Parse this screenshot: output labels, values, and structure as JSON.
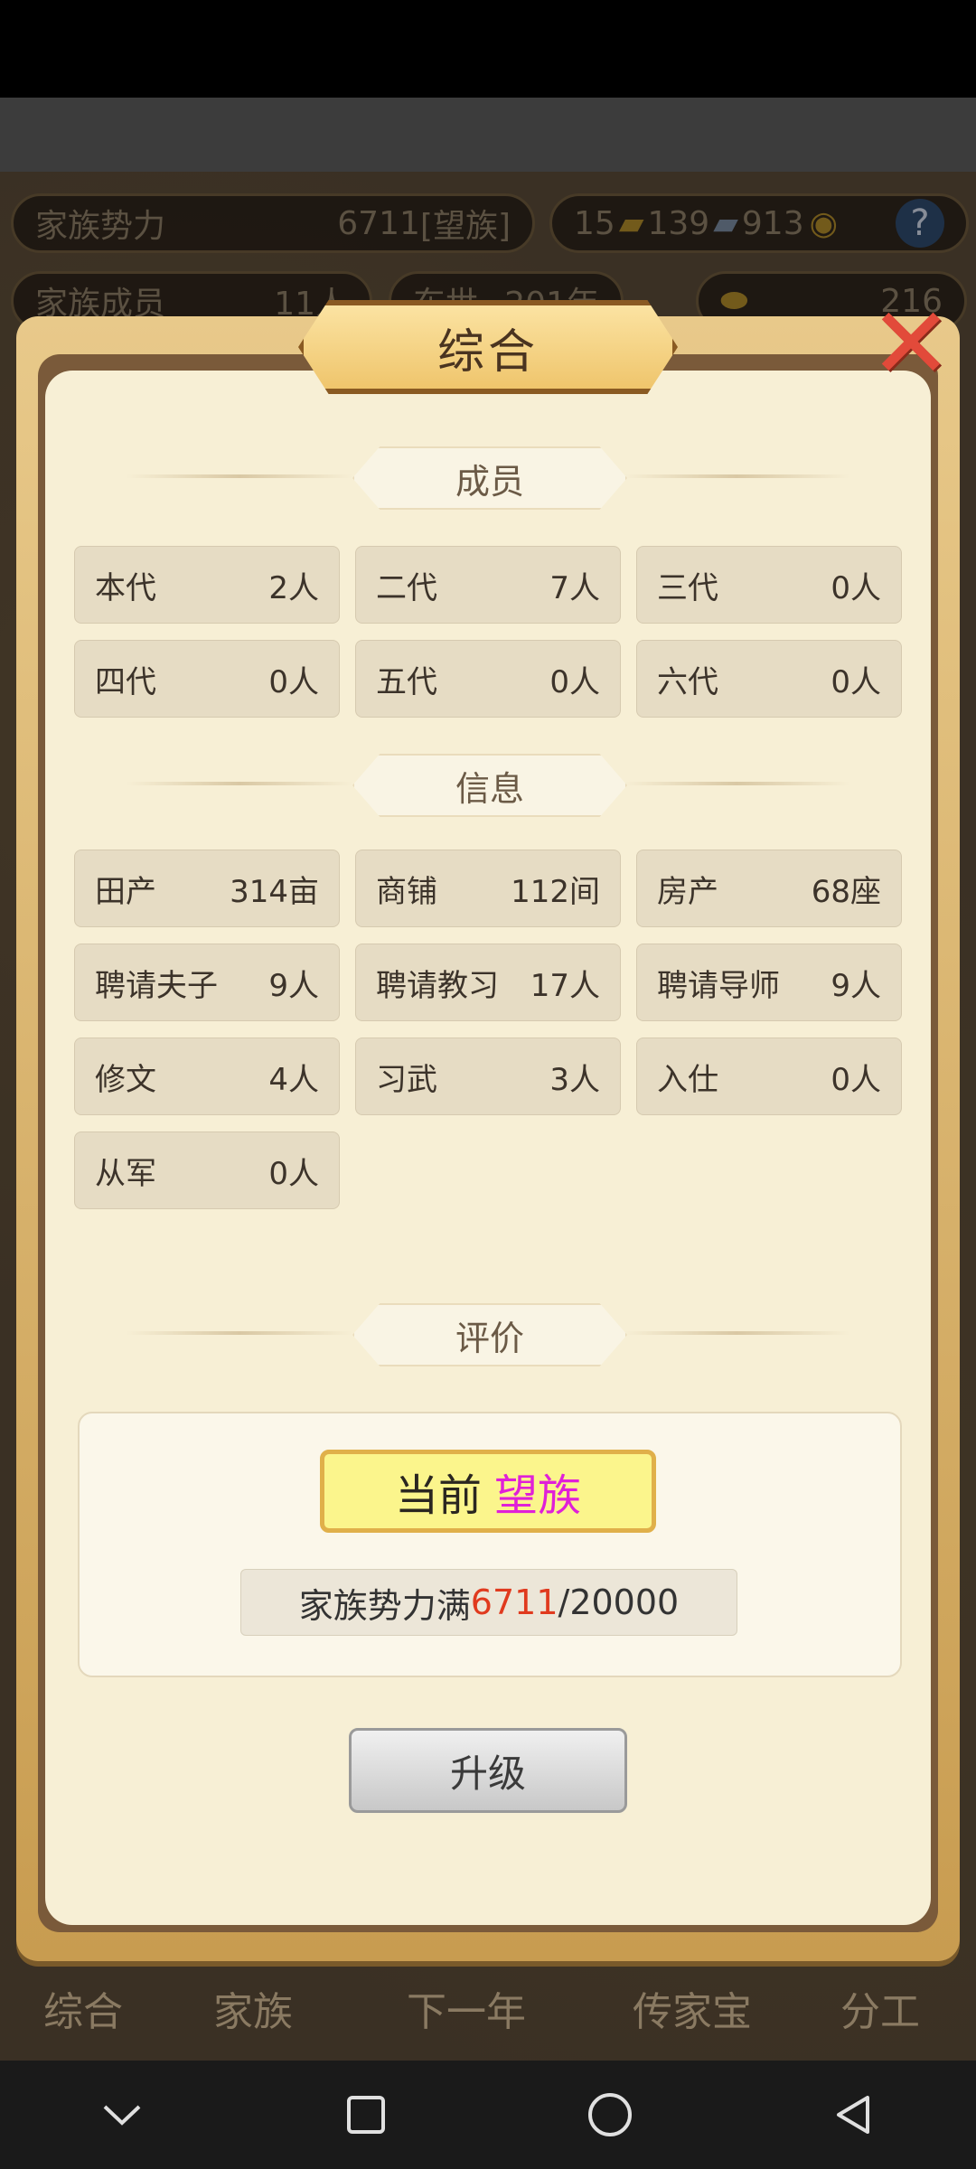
{
  "background": {
    "top_bar": {
      "power_label": "家族势力",
      "power_value": "6711",
      "power_rank_bracket": "[望族]",
      "gold": "15",
      "silver": "139",
      "coins": "913",
      "help_icon": "question-icon"
    },
    "second_bar": {
      "members_label": "家族成员",
      "members_value": "11人",
      "year_label": "东世",
      "year_value": "201年",
      "ingot_value": "216"
    },
    "bottom_tabs": [
      "综合",
      "家族",
      "下一年",
      "传家宝",
      "分工"
    ]
  },
  "dialog": {
    "title": "综合",
    "close_icon": "close-x-icon",
    "sections": {
      "members": {
        "header": "成员",
        "items": [
          {
            "label": "本代",
            "value": "2人"
          },
          {
            "label": "二代",
            "value": "7人"
          },
          {
            "label": "三代",
            "value": "0人"
          },
          {
            "label": "四代",
            "value": "0人"
          },
          {
            "label": "五代",
            "value": "0人"
          },
          {
            "label": "六代",
            "value": "0人"
          }
        ]
      },
      "info": {
        "header": "信息",
        "items": [
          {
            "label": "田产",
            "value": "314亩"
          },
          {
            "label": "商铺",
            "value": "112间"
          },
          {
            "label": "房产",
            "value": "68座"
          },
          {
            "label": "聘请夫子",
            "value": "9人"
          },
          {
            "label": "聘请教习",
            "value": "17人"
          },
          {
            "label": "聘请导师",
            "value": "9人"
          },
          {
            "label": "修文",
            "value": "4人"
          },
          {
            "label": "习武",
            "value": "3人"
          },
          {
            "label": "入仕",
            "value": "0人"
          },
          {
            "label": "从军",
            "value": "0人"
          }
        ]
      },
      "evaluation": {
        "header": "评价",
        "current_label": "当前",
        "current_rank": "望族",
        "power_prefix": "家族势力满",
        "power_current": "6711",
        "power_target": "/20000",
        "colors": {
          "rank": "#e020d8",
          "power_current": "#e03a1e"
        }
      }
    },
    "upgrade_button": "升级"
  },
  "android_nav": {
    "down": "chevron-down-icon",
    "recents": "square-icon",
    "home": "circle-icon",
    "back": "triangle-back-icon"
  }
}
